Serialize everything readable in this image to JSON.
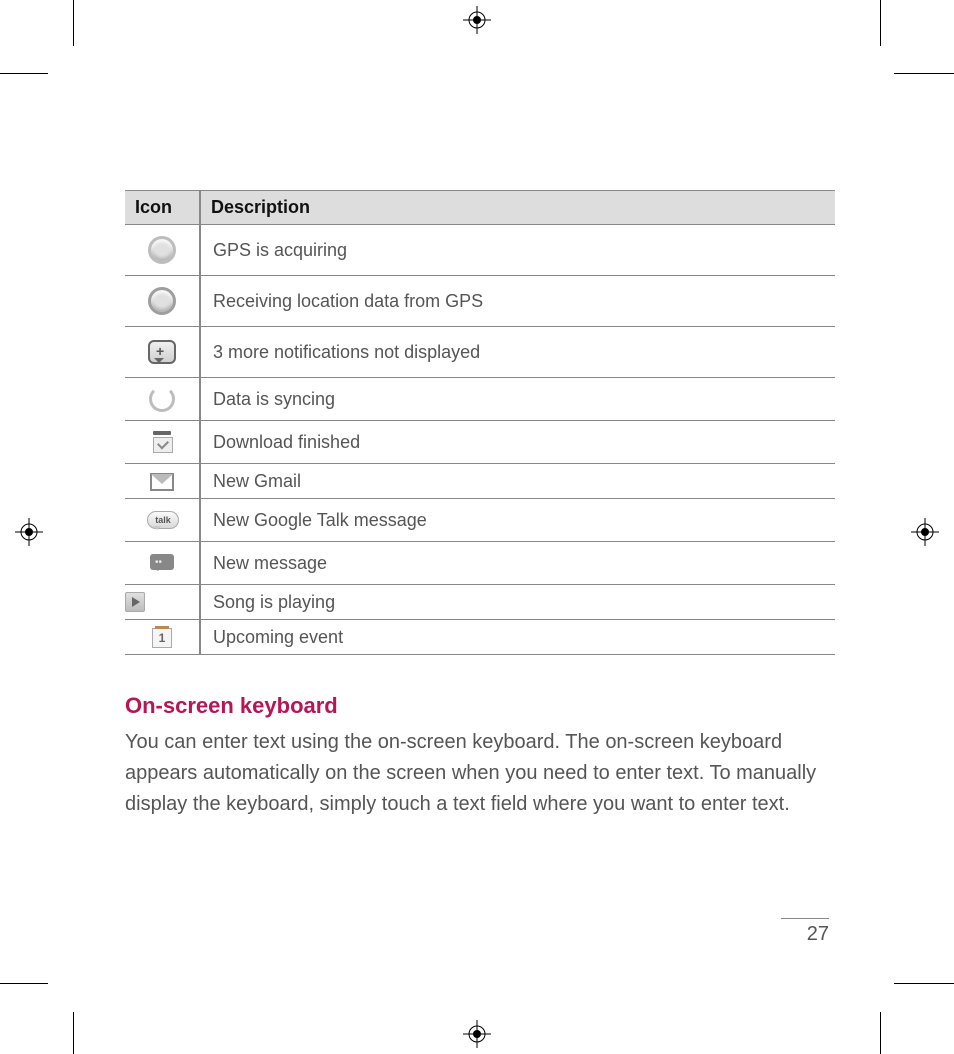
{
  "table": {
    "headers": {
      "icon": "Icon",
      "description": "Description"
    },
    "rows": [
      {
        "icon": "gps-acquiring-icon",
        "desc": "GPS is acquiring",
        "size": "a"
      },
      {
        "icon": "gps-receiving-icon",
        "desc": "Receiving location data from GPS",
        "size": "a"
      },
      {
        "icon": "more-notifications-icon",
        "desc": "3 more notifications not displayed",
        "size": "a"
      },
      {
        "icon": "sync-icon",
        "desc": "Data is syncing",
        "size": "b"
      },
      {
        "icon": "download-finished-icon",
        "desc": "Download finished",
        "size": "b"
      },
      {
        "icon": "gmail-icon",
        "desc": "New Gmail",
        "size": "c"
      },
      {
        "icon": "google-talk-icon",
        "desc": "New Google Talk message",
        "size": "b"
      },
      {
        "icon": "new-message-icon",
        "desc": "New message",
        "size": "b"
      },
      {
        "icon": "song-playing-icon",
        "desc": "Song is playing",
        "size": "c"
      },
      {
        "icon": "upcoming-event-icon",
        "desc": "Upcoming event",
        "size": "c"
      }
    ]
  },
  "section": {
    "heading": "On-screen keyboard",
    "body": "You can enter text using the on-screen keyboard. The on-screen keyboard appears automatically on the screen when you need to enter text. To manually display the keyboard, simply touch a text field where you want to enter text."
  },
  "page_number": "27",
  "talk_label": "talk",
  "calendar_day": "1"
}
